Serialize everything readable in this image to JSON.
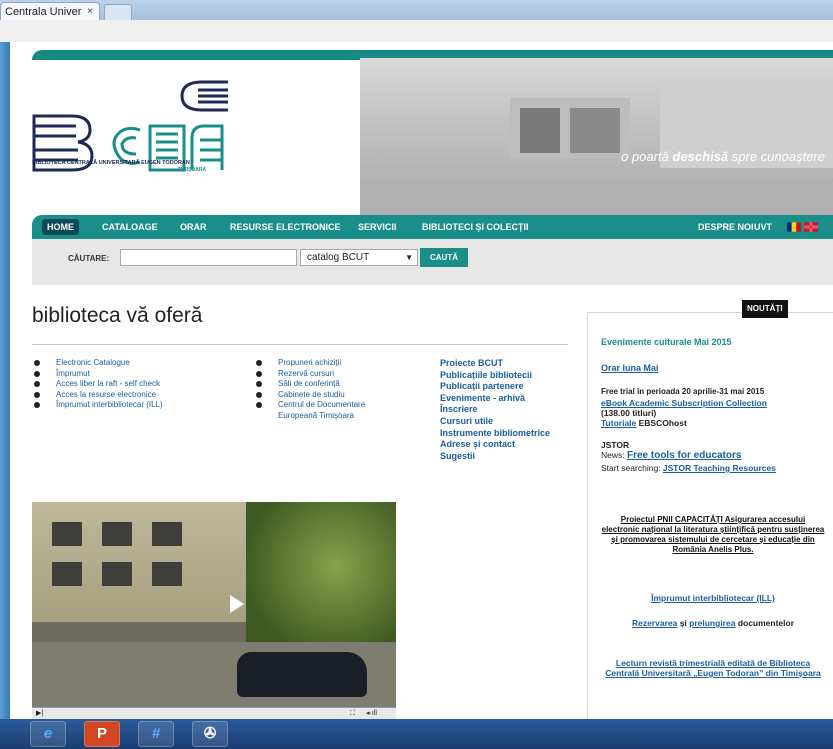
{
  "browser": {
    "tab_title": "Centrala Univer",
    "tab_close": "×"
  },
  "header": {
    "logo_caption": "BIBLIOTECA CENTRALĂ UNIVERSITARĂ EUGEN TODORAN",
    "logo_city": "TIMIȘOARA",
    "tagline_pre": "o poartă ",
    "tagline_bold": "deschisă",
    "tagline_post": " spre cunoaștere"
  },
  "nav": {
    "items": [
      "HOME",
      "CATALOAGE",
      "ORAR",
      "RESURSE ELECTRONICE",
      "SERVICII",
      "BIBLIOTECI ȘI COLECȚII"
    ],
    "right_items": [
      "DESPRE NOI",
      "UVT"
    ]
  },
  "search": {
    "label": "CĂUTARE:",
    "value": "",
    "selected": "catalog BCUT",
    "button": "CAUTĂ"
  },
  "main": {
    "title": "biblioteca vă oferă",
    "col1": [
      "Electronic Catalogue",
      "Împrumut",
      "Acces liber la raft - self check",
      "Acces la resurse electronice",
      "Împrumut interbibliotecar (ILL)"
    ],
    "col2": [
      "Propuneri achiziții",
      "Rezervă cursuri",
      "Săli de conferință",
      "Cabinete de studiu",
      "Centrul de Documentare Europeană Timișoara"
    ],
    "col3": [
      "Proiecte BCUT",
      "Publicațiile bibliotecii",
      "Publicații partenere",
      "Evenimente - arhivă",
      "Înscriere",
      "Cursuri utile",
      "Instrumente bibliometrice",
      "Adrese și contact",
      "Sugestii"
    ]
  },
  "sidebar": {
    "badge": "NOUTĂȚI",
    "events": "Evenimente culturale Mai 2015",
    "orar": "Orar luna Mai",
    "trial_text": "Free trial în perioada 20 aprilie-31 mai 2015",
    "trial_link": "eBook Academic Subscription Collection",
    "trial_count": "(138.00 titluri)",
    "tutorial_link": "Tutoriale",
    "tutorial_text": " EBSCOhost",
    "jstor": "JSTOR",
    "news_label": "News: ",
    "news_link": "Free tools for educators",
    "start_label": "Start searching: ",
    "start_link": "JSTOR Teaching Resources",
    "project": "Proiectul PNII CAPACITĂȚI Asigurarea accesului electronic național la literatura științifică pentru susținerea și promovarea sistemului de cercetare și educație din România Anelis Plus.",
    "ill": "Împrumut interbibliotecar (ILL)",
    "rez_link1": "Rezervarea",
    "rez_mid": " și ",
    "rez_link2": "prelungirea",
    "rez_end": " documentelor",
    "lecturn": "Lecturn revistă trimestrială editată de Biblioteca Centrală Universitară „Eugen Todoran” din Timișoara"
  },
  "colors": {
    "teal": "#1a8f8a",
    "dark_teal": "#0d4b56",
    "link_blue": "#1a5fa0"
  }
}
